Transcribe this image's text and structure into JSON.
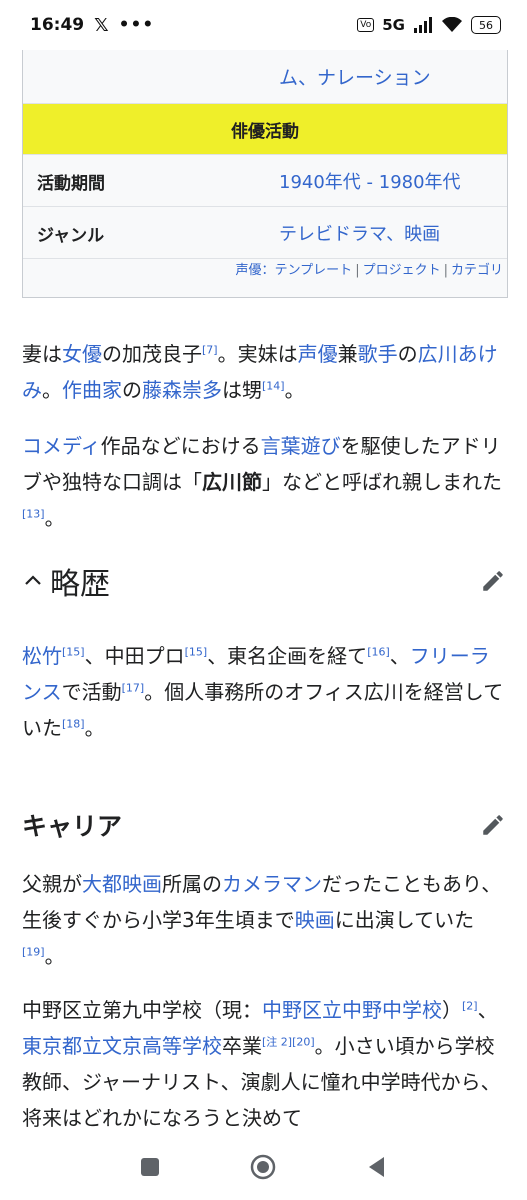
{
  "status_bar": {
    "time": "16:49",
    "x_app": "𝕏",
    "more": "•••",
    "volte": "VoLTE",
    "network": "5G",
    "battery": "56"
  },
  "infobox": {
    "top_value": "ム、ナレーション",
    "heading": "俳優活動",
    "rows": [
      {
        "label": "活動期間",
        "value": "1940年代 - 1980年代"
      },
      {
        "label": "ジャンル",
        "value": "テレビドラマ、映画"
      }
    ],
    "navbox": {
      "prefix": "声優：",
      "links": [
        "テンプレート",
        "プロジェクト",
        "カテゴリ"
      ],
      "separator": "|"
    }
  },
  "article": {
    "p1": {
      "t1": "妻は",
      "l1": "女優",
      "t2": "の加茂良子",
      "r1": "[7]",
      "t3": "。実妹は",
      "l2": "声優",
      "t4": "兼",
      "l3": "歌手",
      "t5": "の",
      "l4": "広川あけみ",
      "t6": "。",
      "l5": "作曲家",
      "t7": "の",
      "l6": "藤森崇多",
      "t8": "は甥",
      "r2": "[14]",
      "t9": "。"
    },
    "p2": {
      "l1": "コメディ",
      "t1": "作品などにおける",
      "l2": "言葉遊び",
      "t2": "を駆使したアドリブや独特な口調は「",
      "b1": "広川節",
      "t3": "」などと呼ばれ親しまれた",
      "r1": "[13]",
      "t4": "。"
    },
    "section1": {
      "title": "略歴",
      "p": {
        "l1": "松竹",
        "r1": "[15]",
        "t1": "、中田プロ",
        "r2": "[15]",
        "t2": "、東名企画を経て",
        "r3": "[16]",
        "t3": "、",
        "l2": "フリーランス",
        "t4": "で活動",
        "r4": "[17]",
        "t5": "。個人事務所のオフィス広川を経営していた",
        "r5": "[18]",
        "t6": "。"
      }
    },
    "section2": {
      "title": "キャリア",
      "p1": {
        "t1": "父親が",
        "l1": "大都映画",
        "t2": "所属の",
        "l2": "カメラマン",
        "t3": "だったこともあり、生後すぐから小学3年生頃まで",
        "l3": "映画",
        "t4": "に出演していた",
        "r1": "[19]",
        "t5": "。"
      },
      "p2": {
        "t1": "中野区立第九中学校（現：",
        "l1": "中野区立中野中学校",
        "t2": "）",
        "r1": "[2]",
        "t3": "、",
        "l2": "東京都立文京高等学校",
        "t4": "卒業",
        "r2": "[注 2][20]",
        "t5": "。小さい頃から学校教師、ジャーナリスト、演劇人に憧れ中学時代から、将来はどれかになろうと決めて"
      }
    }
  },
  "icons": {
    "collapse": "chevron-up-icon",
    "edit": "pencil-icon",
    "recents": "square-icon",
    "home": "circle-home-icon",
    "back": "triangle-back-icon"
  },
  "colors": {
    "link": "#3366cc",
    "heading_bg": "#efef2a",
    "infobox_bg": "#f8f9fa",
    "text": "#202122"
  }
}
